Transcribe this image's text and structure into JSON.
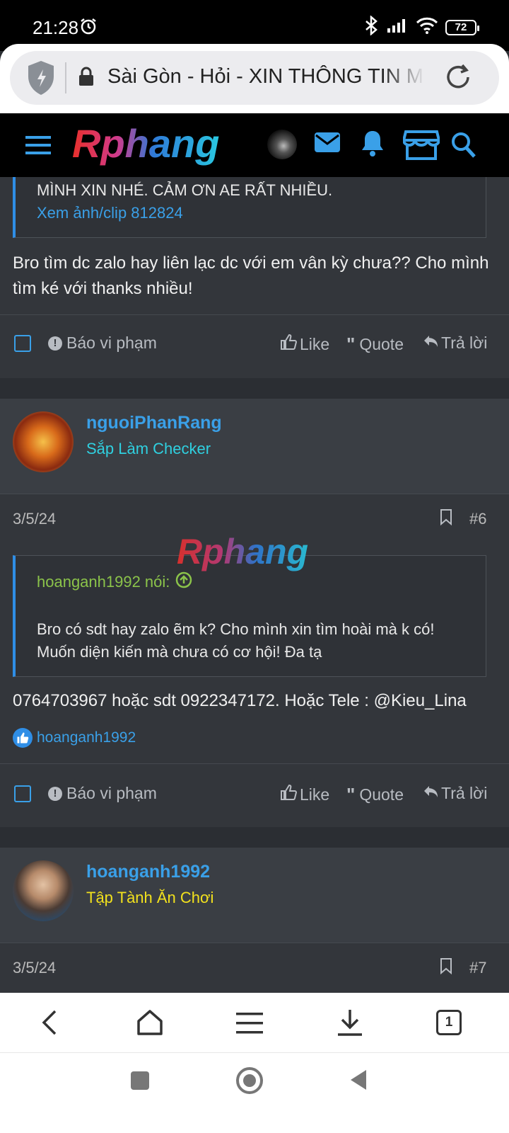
{
  "status": {
    "time": "21:28",
    "battery": "72"
  },
  "browser": {
    "url_text": "Sài Gòn - Hỏi - XIN THÔNG TIN M",
    "tab_count": "1"
  },
  "site": {
    "logo": "Rphang",
    "watermark": "Rphang"
  },
  "post5": {
    "quote_text": "MÌNH XIN NHÉ. CẢM ƠN AE RẤT NHIỀU.",
    "quote_link": "Xem ảnh/clip 812824",
    "body": "Bro tìm dc zalo hay liên lạc dc với em vân kỳ chưa?? Cho mình tìm ké với thanks nhiều!",
    "report": "Báo vi phạm",
    "like": "Like",
    "quote": "Quote",
    "reply": "Trả lời"
  },
  "post6": {
    "username": "nguoiPhanRang",
    "rank": "Sắp Làm Checker",
    "date": "3/5/24",
    "number": "#6",
    "quote_author": "hoanganh1992 nói:",
    "quote_text": "Bro có sdt hay zalo ẽm k? Cho mình xin tìm hoài mà k có! Muốn diện kiến mà chưa có cơ hội! Đa tạ",
    "body": "0764703967 hoặc sdt 0922347172. Hoặc Tele : @Kieu_Lina",
    "liked_by": "hoanganh1992",
    "report": "Báo vi phạm",
    "like": "Like",
    "quote": "Quote",
    "reply": "Trả lời"
  },
  "post7": {
    "username": "hoanganh1992",
    "rank": "Tập Tành Ăn Chơi",
    "date": "3/5/24",
    "number": "#7"
  },
  "colors": {
    "accent": "#3aa0e8",
    "rank6": "#2fd0e0",
    "rank7": "#f2e11d",
    "quote_author": "#8bc34a"
  }
}
